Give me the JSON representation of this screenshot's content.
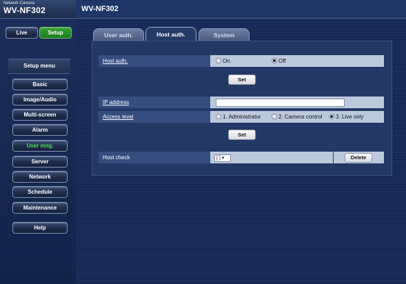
{
  "brand": {
    "sub": "Network Camera",
    "model": "WV-NF302"
  },
  "header": {
    "title": "WV-NF302"
  },
  "top_buttons": {
    "live": "Live",
    "setup": "Setup"
  },
  "menu": {
    "title": "Setup menu",
    "items": [
      "Basic",
      "Image/Audio",
      "Multi-screen",
      "Alarm",
      "User mng.",
      "Server",
      "Network",
      "Schedule",
      "Maintenance"
    ],
    "help": "Help"
  },
  "tabs": {
    "user_auth": "User auth.",
    "host_auth": "Host auth.",
    "system": "System"
  },
  "host_auth": {
    "label": "Host auth.",
    "options": [
      "On",
      "Off"
    ],
    "selected": "Off",
    "set": "Set"
  },
  "ip_address": {
    "label": "IP address",
    "value": ""
  },
  "access_level": {
    "label": "Access level",
    "options": [
      "1. Administrator",
      "2. Camera control",
      "3. Live only"
    ],
    "selected": "3. Live only",
    "set": "Set"
  },
  "host_check": {
    "label": "Host check",
    "select_value": "[ ]",
    "delete": "Delete"
  },
  "colors": {
    "setup_active": "#2a9a2a",
    "active_menu_text": "#48e048"
  }
}
